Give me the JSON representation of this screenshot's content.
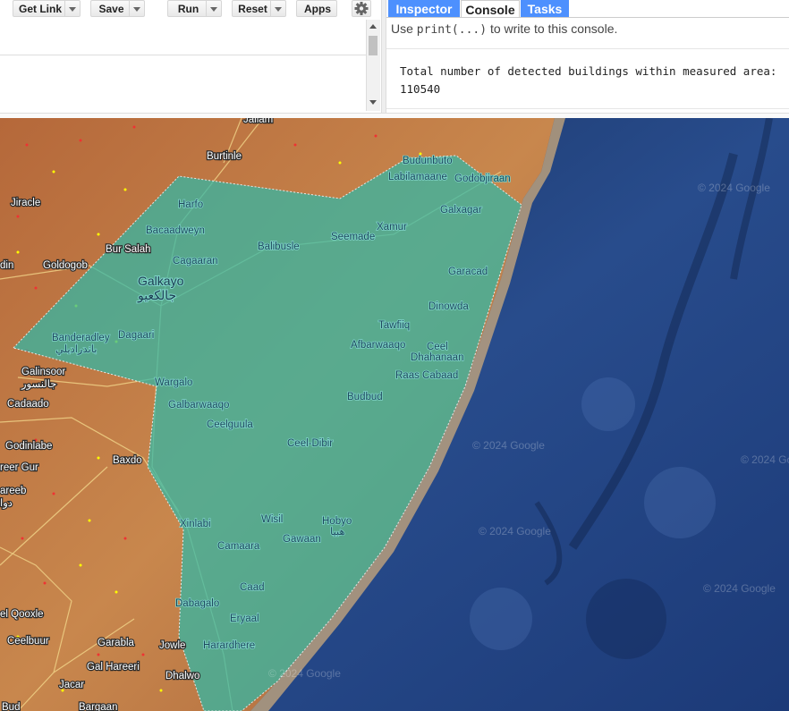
{
  "toolbar": {
    "get_link": "Get Link",
    "save": "Save",
    "run": "Run",
    "reset": "Reset",
    "apps": "Apps"
  },
  "tabs": {
    "inspector": "Inspector",
    "console": "Console",
    "tasks": "Tasks"
  },
  "console": {
    "hint_prefix": "Use ",
    "hint_code": "print(...)",
    "hint_suffix": " to write to this console.",
    "output_label": "Total number of detected buildings within measured area:",
    "output_value": "110540"
  },
  "colors": {
    "tab_blue": "#4d90fe",
    "polygon_fill": "#2fb8a8",
    "ocean": "#1d3a7a",
    "land": "#c06a35"
  },
  "map": {
    "places_outside": [
      {
        "name": "Jaliam"
      },
      {
        "name": "Burtinle"
      },
      {
        "name": "Jiracle"
      },
      {
        "name": "Bur Salah"
      },
      {
        "name": "Goldogob"
      },
      {
        "name": "din"
      },
      {
        "name": "Galinsoor"
      },
      {
        "name": "جالنسور"
      },
      {
        "name": "Cadaado"
      },
      {
        "name": "Godinlabe"
      },
      {
        "name": "reer Gur"
      },
      {
        "name": "Baxdo"
      },
      {
        "name": "areeb"
      },
      {
        "name": "دوا"
      },
      {
        "name": "el Qooxle"
      },
      {
        "name": "Ceelbuur"
      },
      {
        "name": "Garabla"
      },
      {
        "name": "Jowle"
      },
      {
        "name": "Gal Hareeri"
      },
      {
        "name": "Dhalwo"
      },
      {
        "name": "Jacar"
      },
      {
        "name": "Bargaan"
      },
      {
        "name": "Bud"
      }
    ],
    "places_inside": [
      {
        "name": "Budunbuto"
      },
      {
        "name": "Labilamaane"
      },
      {
        "name": "Godobjiraan"
      },
      {
        "name": "Harfo"
      },
      {
        "name": "Galxagar"
      },
      {
        "name": "Xamur"
      },
      {
        "name": "Bacaadweyn"
      },
      {
        "name": "Seemade"
      },
      {
        "name": "Balibusle"
      },
      {
        "name": "Cagaaran"
      },
      {
        "name": "Garacad"
      },
      {
        "name": "Dinowda"
      },
      {
        "name": "Tawfiiq"
      },
      {
        "name": "Banderadley"
      },
      {
        "name": "باندراديلي"
      },
      {
        "name": "Dagaari"
      },
      {
        "name": "Afbarwaaqo"
      },
      {
        "name": "Ceel"
      },
      {
        "name": "Dhahanaan"
      },
      {
        "name": "Raas Cabaad"
      },
      {
        "name": "Wargalo"
      },
      {
        "name": "Budbud"
      },
      {
        "name": "Galbarwaaqo"
      },
      {
        "name": "Ceelguula"
      },
      {
        "name": "Ceel-Dibir"
      },
      {
        "name": "Xinlabi"
      },
      {
        "name": "Wisil"
      },
      {
        "name": "Hobyo"
      },
      {
        "name": "هبيا"
      },
      {
        "name": "Gawaan"
      },
      {
        "name": "Camaara"
      },
      {
        "name": "Caad"
      },
      {
        "name": "Dabagalo"
      },
      {
        "name": "Eryaal"
      },
      {
        "name": "Harardhere"
      }
    ],
    "city": {
      "name": "Galkayo",
      "name_ar": "جالكعيو"
    },
    "watermark": "© 2024 Google"
  }
}
